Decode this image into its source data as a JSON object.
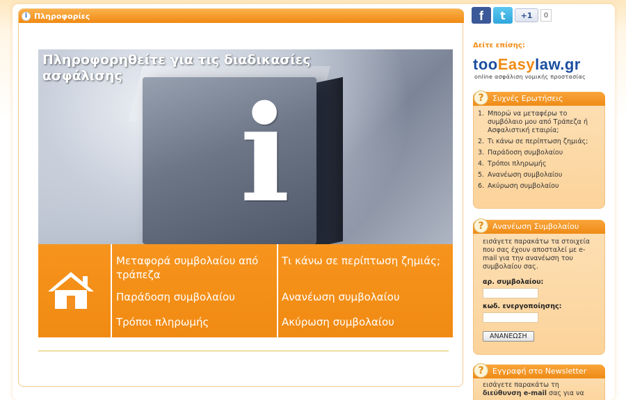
{
  "main": {
    "header_title": "Πληροφορίες",
    "banner": {
      "title": "Πληροφορηθείτε για τις διαδικασίες ασφάλισης",
      "info_letter": "i",
      "menu": {
        "col1": [
          "Μεταφορά συμβολαίου από τράπεζα",
          "Παράδοση συμβολαίου",
          "Τρόποι πληρωμής"
        ],
        "col2": [
          "Τι κάνω σε περίπτωση ζημιάς;",
          "Ανανέωση συμβολαίου",
          "Ακύρωση συμβολαίου"
        ]
      }
    }
  },
  "social": {
    "facebook_glyph": "f",
    "twitter_glyph": "t",
    "plus_label": "+1",
    "plus_count": "0"
  },
  "see_also": "Δείτε επίσης:",
  "logo": {
    "part1": "too",
    "part2": "Easy",
    "part3": "law.gr",
    "tagline": "online ασφάλιση νομικής προστασίας"
  },
  "faq": {
    "badge": "?",
    "title": "Συχνές Ερωτήσεις",
    "items": [
      {
        "num": "1.",
        "text": "Μπορώ να μεταφέρω το συμβόλαιο μου από Τράπεζα ή Ασφαλιστική εταιρία;"
      },
      {
        "num": "2.",
        "text": "Τι κάνω σε περίπτωση ζημιάς;"
      },
      {
        "num": "3.",
        "text": "Παράδοση συμβολαίου"
      },
      {
        "num": "4.",
        "text": "Τρόποι πληρωμής"
      },
      {
        "num": "5.",
        "text": "Ανανέωση συμβολαίου"
      },
      {
        "num": "6.",
        "text": "Ακύρωση συμβολαίου"
      }
    ]
  },
  "renewal": {
    "badge": "?",
    "title": "Ανανέωση Συμβολαίου",
    "description": "εισάγετε παρακάτω τα στοιχεία που σας έχουν αποσταλεί με e-mail για την ανανέωση του συμβολαίου σας.",
    "policy_label": "αρ. συμβολαίου:",
    "policy_value": "",
    "code_label": "κωδ. ενεργοποίησης:",
    "code_value": "",
    "button": "ΑΝΑΝΕΩΣΗ"
  },
  "newsletter": {
    "badge": "?",
    "title": "Εγγραφή στο Newsletter",
    "line1": "εισάγετε παρακάτω τη",
    "line2_bold": "διεύθυνση e-mail",
    "line2_rest": " σας για να"
  }
}
